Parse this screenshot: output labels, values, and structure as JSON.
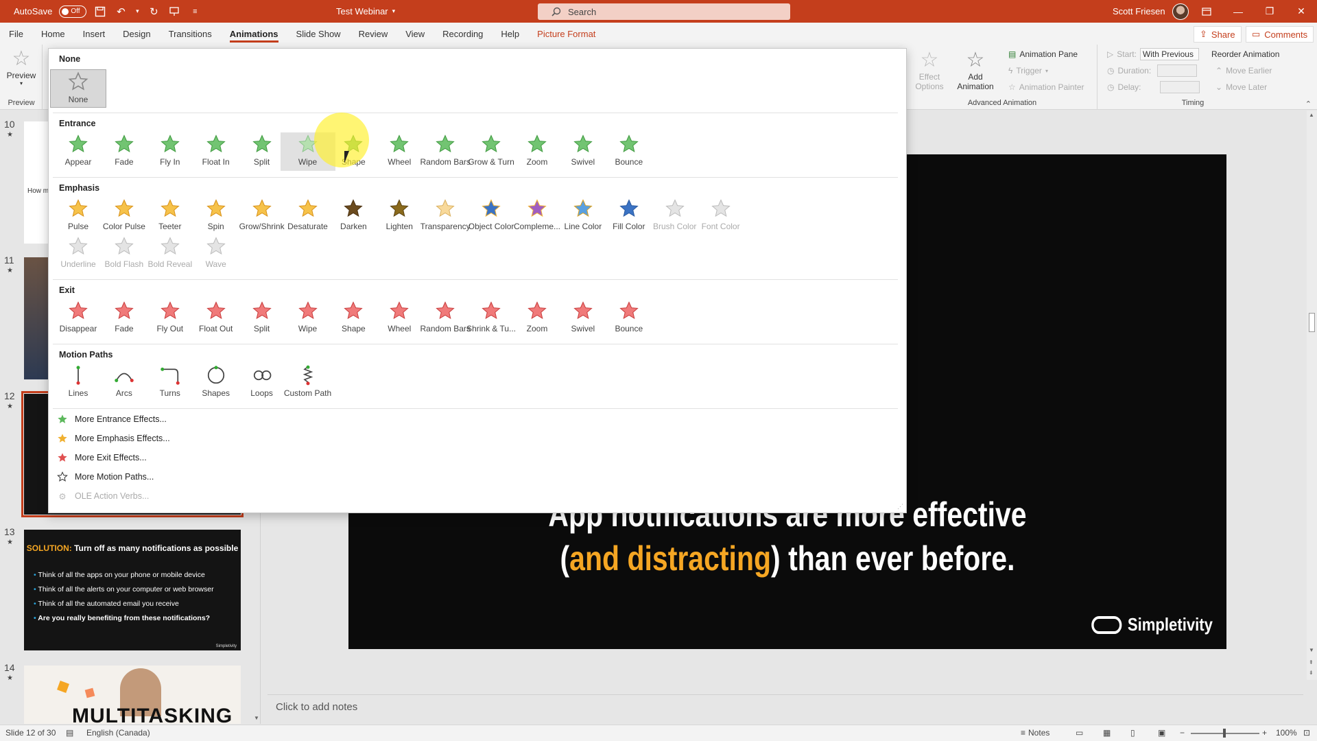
{
  "titlebar": {
    "autosave_label": "AutoSave",
    "autosave_state": "Off",
    "doc_title": "Test Webinar",
    "search_placeholder": "Search",
    "user_name": "Scott Friesen"
  },
  "ribbon_tabs": [
    "File",
    "Home",
    "Insert",
    "Design",
    "Transitions",
    "Animations",
    "Slide Show",
    "Review",
    "View",
    "Recording",
    "Help",
    "Picture Format"
  ],
  "active_tab": "Animations",
  "share_label": "Share",
  "comments_label": "Comments",
  "ribbon": {
    "preview_label": "Preview",
    "preview_group_label": "Preview",
    "effect_options_label": "Effect Options",
    "add_animation_label": "Add Animation",
    "animation_pane_label": "Animation Pane",
    "trigger_label": "Trigger",
    "animation_painter_label": "Animation Painter",
    "advanced_group_label": "Advanced Animation",
    "start_label": "Start:",
    "start_value": "With Previous",
    "duration_label": "Duration:",
    "delay_label": "Delay:",
    "reorder_label": "Reorder Animation",
    "move_earlier_label": "Move Earlier",
    "move_later_label": "Move Later",
    "timing_group_label": "Timing"
  },
  "gallery": {
    "none_section": "None",
    "none_item": "None",
    "entrance_title": "Entrance",
    "entrance": [
      "Appear",
      "Fade",
      "Fly In",
      "Float In",
      "Split",
      "Wipe",
      "Shape",
      "Wheel",
      "Random Bars",
      "Grow & Turn",
      "Zoom",
      "Swivel",
      "Bounce"
    ],
    "emphasis_title": "Emphasis",
    "emphasis_row1": [
      "Pulse",
      "Color Pulse",
      "Teeter",
      "Spin",
      "Grow/Shrink",
      "Desaturate",
      "Darken",
      "Lighten",
      "Transparency",
      "Object Color",
      "Compleme...",
      "Line Color",
      "Fill Color",
      "Brush Color",
      "Font Color"
    ],
    "emphasis_row2": [
      "Underline",
      "Bold Flash",
      "Bold Reveal",
      "Wave"
    ],
    "exit_title": "Exit",
    "exit": [
      "Disappear",
      "Fade",
      "Fly Out",
      "Float Out",
      "Split",
      "Wipe",
      "Shape",
      "Wheel",
      "Random Bars",
      "Shrink & Tu...",
      "Zoom",
      "Swivel",
      "Bounce"
    ],
    "motion_title": "Motion Paths",
    "motion": [
      "Lines",
      "Arcs",
      "Turns",
      "Shapes",
      "Loops",
      "Custom Path"
    ],
    "more": [
      "More Entrance Effects...",
      "More Emphasis Effects...",
      "More Exit Effects...",
      "More Motion Paths...",
      "OLE Action Verbs..."
    ]
  },
  "thumbnails": {
    "numbers": [
      "10",
      "11",
      "12",
      "13",
      "14"
    ],
    "slide10_text": "How m",
    "slide13_title_prefix": "SOLUTION:",
    "slide13_title": "Turn off as many notifications as possible",
    "slide13_bullets": [
      "Think of all the apps on your phone or mobile device",
      "Think of all the alerts on your computer or web browser",
      "Think of all the automated email you receive",
      "Are you really benefiting from these notifications?"
    ],
    "slide13_logo": "Simpletivity",
    "slide14_text": "MULTITASKING"
  },
  "slide": {
    "line1": "App notifications are more effective",
    "line2_open": "(",
    "line2_highlight": "and distracting",
    "line2_rest": ") than ever before.",
    "logo_text": "Simpletivity"
  },
  "notes_placeholder": "Click to add notes",
  "statusbar": {
    "slide_info": "Slide 12 of 30",
    "language": "English (Canada)",
    "notes_label": "Notes",
    "zoom": "100%"
  },
  "colors": {
    "accent": "#c43e1c",
    "entrance_green": "#5cb85c",
    "emphasis_gold": "#f0b030",
    "exit_red": "#e05050",
    "slide_highlight": "#f5a623"
  }
}
